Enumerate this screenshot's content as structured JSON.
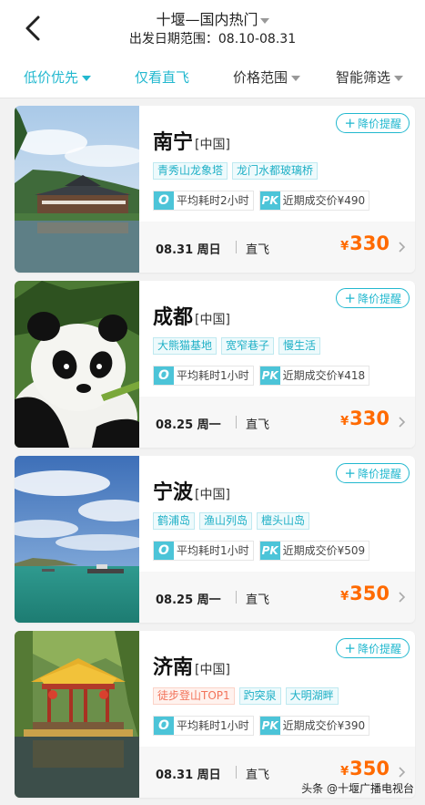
{
  "header": {
    "title": "十堰—国内热门",
    "date_range": "出发日期范围：08.10-08.31"
  },
  "filters": {
    "sort": "低价优先",
    "direct_only": "仅看直飞",
    "price_range": "价格范围",
    "smart_filter": "智能筛选"
  },
  "colors": {
    "accent": "#22b8cf",
    "price": "#ff6a00",
    "hot_tag": "#f2735a"
  },
  "cards": [
    {
      "city": "南宁",
      "country": "[中国]",
      "remind": "降价提醒",
      "tags": [
        {
          "text": "青秀山龙象塔"
        },
        {
          "text": "龙门水都玻璃桥"
        }
      ],
      "duration": "平均耗时2小时",
      "recent_price": "近期成交价¥490",
      "date": "08.31 周日",
      "flight_type": "直飞",
      "currency": "¥",
      "price": "330"
    },
    {
      "city": "成都",
      "country": "[中国]",
      "remind": "降价提醒",
      "tags": [
        {
          "text": "大熊猫基地"
        },
        {
          "text": "宽窄巷子"
        },
        {
          "text": "慢生活"
        }
      ],
      "duration": "平均耗时1小时",
      "recent_price": "近期成交价¥418",
      "date": "08.25 周一",
      "flight_type": "直飞",
      "currency": "¥",
      "price": "330"
    },
    {
      "city": "宁波",
      "country": "[中国]",
      "remind": "降价提醒",
      "tags": [
        {
          "text": "鹤浦岛"
        },
        {
          "text": "渔山列岛"
        },
        {
          "text": "檀头山岛"
        }
      ],
      "duration": "平均耗时1小时",
      "recent_price": "近期成交价¥509",
      "date": "08.25 周一",
      "flight_type": "直飞",
      "currency": "¥",
      "price": "350"
    },
    {
      "city": "济南",
      "country": "[中国]",
      "remind": "降价提醒",
      "tags": [
        {
          "text": "徒步登山TOP1",
          "hot": true
        },
        {
          "text": "趵突泉"
        },
        {
          "text": "大明湖畔"
        }
      ],
      "duration": "平均耗时1小时",
      "recent_price": "近期成交价¥390",
      "date": "08.31 周日",
      "flight_type": "直飞",
      "currency": "¥",
      "price": "350"
    }
  ],
  "watermark": "头条 @十堰广播电视台"
}
